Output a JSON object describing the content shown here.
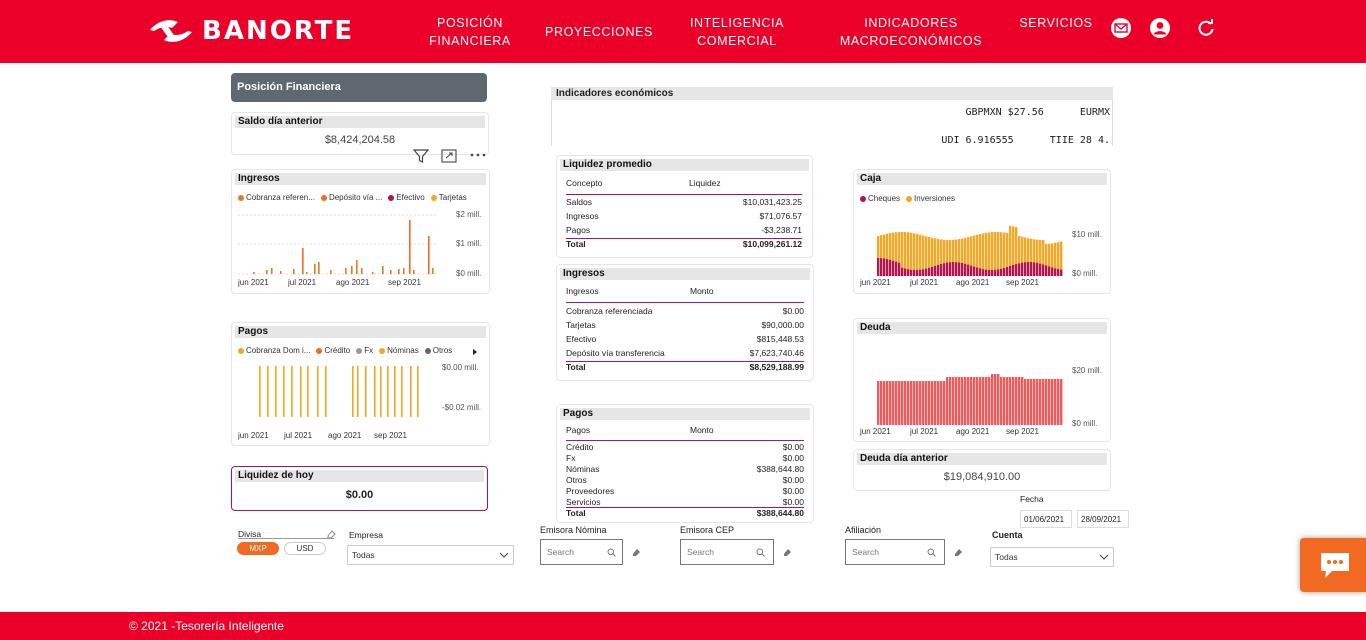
{
  "header": {
    "logo_text": "BANORTE",
    "nav": [
      {
        "line1": "POSICIÓN",
        "line2": "FINANCIERA"
      },
      {
        "line1": "PROYECCIONES",
        "line2": ""
      },
      {
        "line1": "INTELIGENCIA",
        "line2": "COMERCIAL"
      },
      {
        "line1": "INDICADORES",
        "line2": "MACROECONÓMICOS"
      },
      {
        "line1": "SERVICIOS",
        "line2": ""
      }
    ],
    "icons": [
      "mail-icon",
      "user-icon",
      "refresh-icon"
    ]
  },
  "colors": {
    "brand": "#eb0029",
    "orange": "#f5a623",
    "dark_orange": "#f26a21",
    "magenta": "#b5134b",
    "bar_red": "#f05a5a",
    "gray_header": "#5f6770"
  },
  "posicion": {
    "title": "Posición Financiera",
    "saldo_title": "Saldo día anterior",
    "saldo_value": "$8,424,204.58",
    "liquidez_hoy_title": "Liquidez de hoy",
    "liquidez_hoy_value": "$0.00"
  },
  "ingresos_chart": {
    "title": "Ingresos",
    "legend": [
      {
        "label": "Cobranza referen...",
        "color": "#e07b26"
      },
      {
        "label": "Depósito vía ...",
        "color": "#f26a21"
      },
      {
        "label": "Efectivo",
        "color": "#b5134b"
      },
      {
        "label": "Tarjetas",
        "color": "#f5a623"
      }
    ],
    "y_ticks": [
      "$2 mill.",
      "$1 mill.",
      "$0 mill."
    ],
    "x_ticks": [
      "jun 2021",
      "jul 2021",
      "ago 2021",
      "sep 2021"
    ]
  },
  "pagos_chart": {
    "title": "Pagos",
    "legend": [
      {
        "label": "Cobranza Dom i...",
        "color": "#f5a623"
      },
      {
        "label": "Crédito",
        "color": "#f26a21"
      },
      {
        "label": "Fx",
        "color": "#999999"
      },
      {
        "label": "Nóminas",
        "color": "#f5a623"
      },
      {
        "label": "Otros",
        "color": "#666666"
      }
    ],
    "y_ticks": [
      "$0.00 mill.",
      "-$0.02 mill."
    ],
    "x_ticks": [
      "jun 2021",
      "jul 2021",
      "ago 2021",
      "sep 2021"
    ]
  },
  "indicadores": {
    "title": "Indicadores económicos",
    "ticker1": "GBPMXN $27.56      EURMX",
    "ticker2": "UDI 6.916555      TIIE 28 4."
  },
  "liquidez_promedio": {
    "title": "Liquidez promedio",
    "headers": [
      "Concepto",
      "Liquidez"
    ],
    "rows": [
      [
        "Saldos",
        "$10,031,423.25"
      ],
      [
        "Ingresos",
        "$71,076.57"
      ],
      [
        "Pagos",
        "-$3,238.71"
      ]
    ],
    "total": [
      "Total",
      "$10,099,261.12"
    ]
  },
  "ingresos_table": {
    "title": "Ingresos",
    "headers": [
      "Ingresos",
      "Monto"
    ],
    "rows": [
      [
        "Cobranza referenciada",
        "$0.00"
      ],
      [
        "Tarjetas",
        "$90,000.00"
      ],
      [
        "Efectivo",
        "$815,448.53"
      ],
      [
        "Depósito vía transferencia",
        "$7,623,740.46"
      ]
    ],
    "total": [
      "Total",
      "$8,529,188.99"
    ]
  },
  "pagos_table": {
    "title": "Pagos",
    "headers": [
      "Pagos",
      "Monto"
    ],
    "rows": [
      [
        "Crédito",
        "$0.00"
      ],
      [
        "Fx",
        "$0.00"
      ],
      [
        "Nóminas",
        "$388,644.80"
      ],
      [
        "Otros",
        "$0.00"
      ],
      [
        "Proveedores",
        "$0.00"
      ],
      [
        "Servicios",
        "$0.00"
      ]
    ],
    "total": [
      "Total",
      "$388,644.80"
    ]
  },
  "caja_chart": {
    "title": "Caja",
    "legend": [
      {
        "label": "Cheques",
        "color": "#b5134b"
      },
      {
        "label": "Inversiones",
        "color": "#f5a623"
      }
    ],
    "y_ticks": [
      "$10 mill.",
      "$0 mill."
    ],
    "x_ticks": [
      "jun 2021",
      "jul 2021",
      "ago 2021",
      "sep 2021"
    ]
  },
  "deuda_chart": {
    "title": "Deuda",
    "y_ticks": [
      "$20 mill.",
      "$0 mill."
    ],
    "x_ticks": [
      "jun 2021",
      "jul 2021",
      "ago 2021",
      "sep 2021"
    ]
  },
  "deuda_anterior": {
    "title": "Deuda día anterior",
    "value": "$19,084,910.00"
  },
  "filters": {
    "divisa_label": "Divisa",
    "divisa_options": [
      "MXP",
      "USD"
    ],
    "empresa_label": "Empresa",
    "empresa_value": "Todas",
    "emisora_nomina_label": "Emisora Nómina",
    "emisora_cep_label": "Emisora CEP",
    "afiliacion_label": "Afiliación",
    "search_placeholder": "Search",
    "cuenta_label": "Cuenta",
    "cuenta_value": "Todas",
    "fecha_label": "Fecha",
    "fecha_from": "01/06/2021",
    "fecha_to": "28/09/2021"
  },
  "footer": {
    "text": "© 2021 -Tesorería Inteligente"
  }
}
